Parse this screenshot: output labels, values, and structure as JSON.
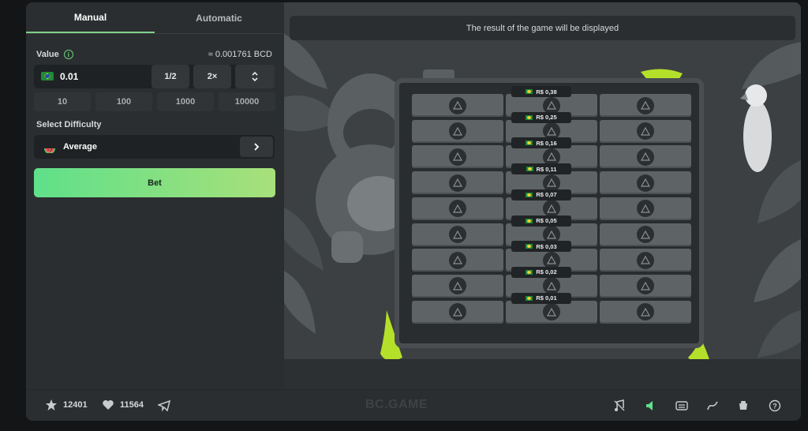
{
  "tabs": [
    "Manual",
    "Automatic"
  ],
  "value": {
    "label": "Value",
    "info_icon": "info-icon",
    "approx": "≈ 0.001761 BCD",
    "amount": "0.01",
    "half_label": "1/2",
    "double_label": "2×"
  },
  "quick_amounts": [
    "10",
    "100",
    "1000",
    "10000"
  ],
  "difficulty": {
    "label": "Select Difficulty",
    "selected": "Average"
  },
  "bet_label": "Bet",
  "result_text": "The result of the game will be displayed",
  "prizes": [
    "R$ 0,38",
    "R$ 0,25",
    "R$ 0,16",
    "R$ 0,11",
    "R$ 0,07",
    "R$ 0,05",
    "R$ 0,03",
    "R$ 0,02",
    "R$ 0,01"
  ],
  "bottom": {
    "stars": "12401",
    "likes": "11564",
    "brand": "BC.GAME"
  },
  "colors": {
    "accent": "#7fcf8a",
    "bet_start": "#5fe08a",
    "bet_end": "#a8e07a"
  }
}
